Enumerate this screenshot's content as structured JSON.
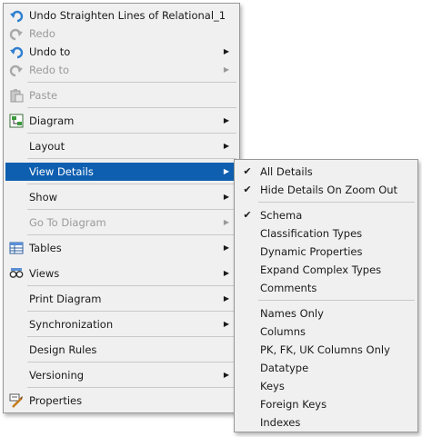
{
  "main_menu": {
    "items": [
      {
        "label": "Undo Straighten Lines of Relational_1",
        "icon": "undo-icon",
        "disabled": false,
        "submenu": false
      },
      {
        "label": "Redo",
        "icon": "redo-icon",
        "disabled": true,
        "submenu": false
      },
      {
        "label": "Undo to",
        "icon": "undo-icon",
        "disabled": false,
        "submenu": true
      },
      {
        "label": "Redo to",
        "icon": "redo-icon",
        "disabled": true,
        "submenu": true
      },
      {
        "label": "Paste",
        "icon": "paste-icon",
        "disabled": true,
        "submenu": false
      },
      {
        "label": "Diagram",
        "icon": "diagram-icon",
        "disabled": false,
        "submenu": true
      },
      {
        "label": "Layout",
        "icon": "",
        "disabled": false,
        "submenu": true
      },
      {
        "label": "View Details",
        "icon": "",
        "disabled": false,
        "submenu": true,
        "highlighted": true
      },
      {
        "label": "Show",
        "icon": "",
        "disabled": false,
        "submenu": true
      },
      {
        "label": "Go To Diagram",
        "icon": "",
        "disabled": true,
        "submenu": true
      },
      {
        "label": "Tables",
        "icon": "tables-icon",
        "disabled": false,
        "submenu": true
      },
      {
        "label": "Views",
        "icon": "views-icon",
        "disabled": false,
        "submenu": true
      },
      {
        "label": "Print Diagram",
        "icon": "",
        "disabled": false,
        "submenu": true
      },
      {
        "label": "Synchronization",
        "icon": "",
        "disabled": false,
        "submenu": true
      },
      {
        "label": "Design Rules",
        "icon": "",
        "disabled": false,
        "submenu": false
      },
      {
        "label": "Versioning",
        "icon": "",
        "disabled": false,
        "submenu": true
      },
      {
        "label": "Properties",
        "icon": "properties-icon",
        "disabled": false,
        "submenu": false
      }
    ]
  },
  "sub_menu": {
    "items": [
      {
        "label": "All Details",
        "checked": true
      },
      {
        "label": "Hide Details On Zoom Out",
        "checked": true
      },
      {
        "label": "Schema",
        "checked": true
      },
      {
        "label": "Classification Types",
        "checked": false
      },
      {
        "label": "Dynamic Properties",
        "checked": false
      },
      {
        "label": "Expand Complex Types",
        "checked": false
      },
      {
        "label": "Comments",
        "checked": false
      },
      {
        "label": "Names Only",
        "checked": false
      },
      {
        "label": "Columns",
        "checked": false
      },
      {
        "label": "PK, FK, UK Columns Only",
        "checked": false
      },
      {
        "label": "Datatype",
        "checked": false
      },
      {
        "label": "Keys",
        "checked": false
      },
      {
        "label": "Foreign Keys",
        "checked": false
      },
      {
        "label": "Indexes",
        "checked": false
      }
    ]
  },
  "glyphs": {
    "submenu_arrow": "▶",
    "check": "✔"
  },
  "colors": {
    "highlight": "#0e5fb0",
    "menu_bg": "#f0f0f0",
    "disabled_text": "#9a9a9a"
  }
}
